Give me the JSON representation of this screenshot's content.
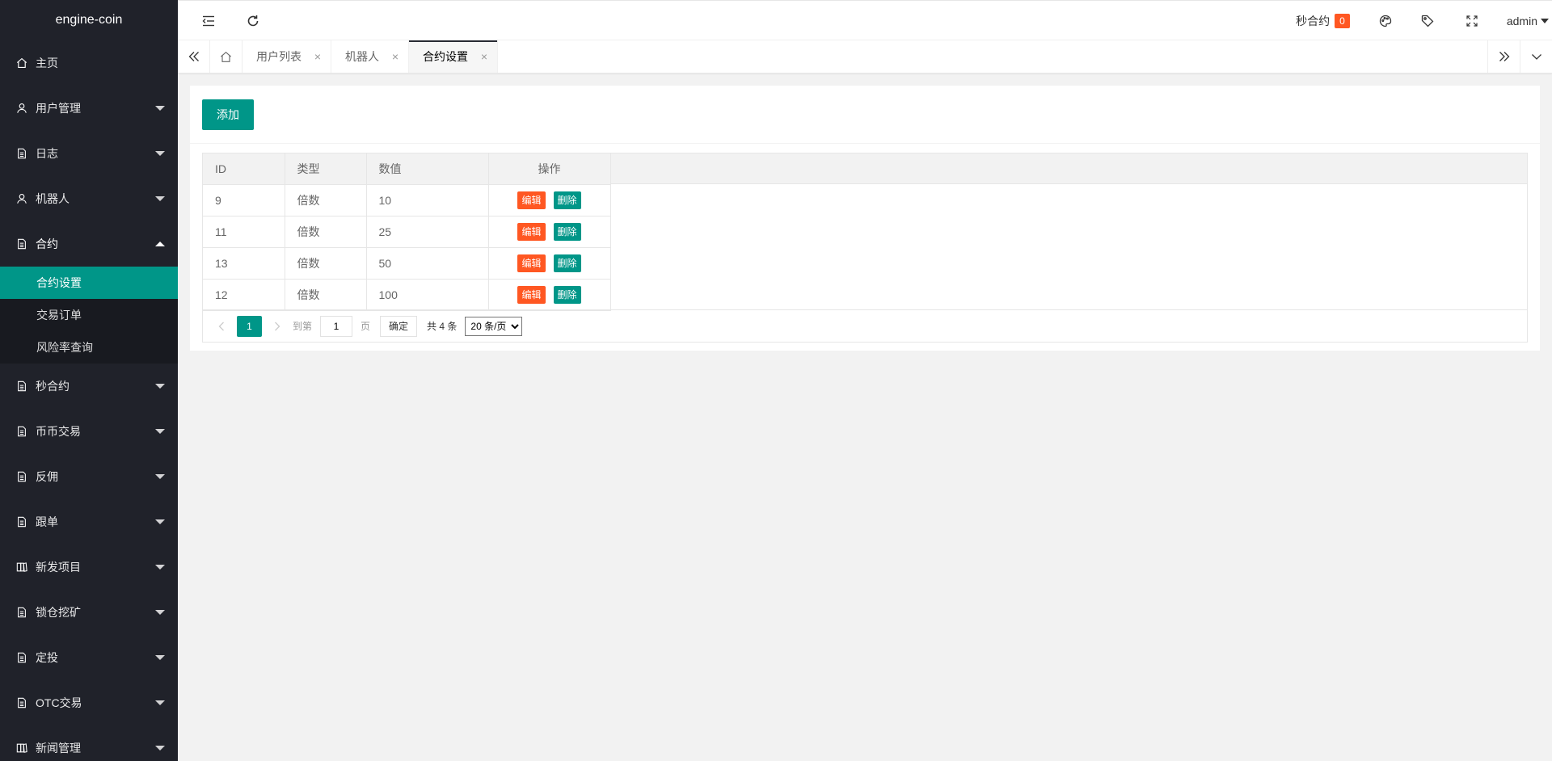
{
  "app": {
    "title": "engine-coin"
  },
  "sidebar": {
    "items": [
      {
        "label": "主页",
        "icon": "home-icon"
      },
      {
        "label": "用户管理",
        "icon": "user-icon"
      },
      {
        "label": "日志",
        "icon": "doc-icon"
      },
      {
        "label": "机器人",
        "icon": "user-icon"
      },
      {
        "label": "合约",
        "icon": "doc-icon",
        "open": true,
        "children": [
          {
            "label": "合约设置",
            "active": true
          },
          {
            "label": "交易订单"
          },
          {
            "label": "风险率查询"
          }
        ]
      },
      {
        "label": "秒合约",
        "icon": "doc-icon"
      },
      {
        "label": "币币交易",
        "icon": "doc-icon"
      },
      {
        "label": "反佣",
        "icon": "doc-icon"
      },
      {
        "label": "跟单",
        "icon": "doc-icon"
      },
      {
        "label": "新发项目",
        "icon": "book-icon"
      },
      {
        "label": "锁仓挖矿",
        "icon": "doc-icon"
      },
      {
        "label": "定投",
        "icon": "doc-icon"
      },
      {
        "label": "OTC交易",
        "icon": "doc-icon"
      },
      {
        "label": "新闻管理",
        "icon": "book-icon"
      }
    ]
  },
  "header": {
    "second_contract_label": "秒合约",
    "second_contract_count": "0",
    "user_label": "admin"
  },
  "tabs": [
    {
      "label": "用户列表"
    },
    {
      "label": "机器人"
    },
    {
      "label": "合约设置",
      "active": true
    }
  ],
  "main": {
    "add_label": "添加",
    "columns": [
      "ID",
      "类型",
      "数值",
      "操作"
    ],
    "rows": [
      {
        "id": "9",
        "type": "倍数",
        "value": "10"
      },
      {
        "id": "11",
        "type": "倍数",
        "value": "25"
      },
      {
        "id": "13",
        "type": "倍数",
        "value": "50"
      },
      {
        "id": "12",
        "type": "倍数",
        "value": "100"
      }
    ],
    "edit_label": "编辑",
    "delete_label": "删除"
  },
  "pager": {
    "current": "1",
    "goto_label": "到第",
    "goto_value": "1",
    "page_label": "页",
    "confirm_label": "确定",
    "total_label": "共 4 条",
    "page_size": "20 条/页"
  },
  "colors": {
    "primary": "#009688",
    "danger": "#ff5722",
    "sidebar": "#20222a"
  }
}
